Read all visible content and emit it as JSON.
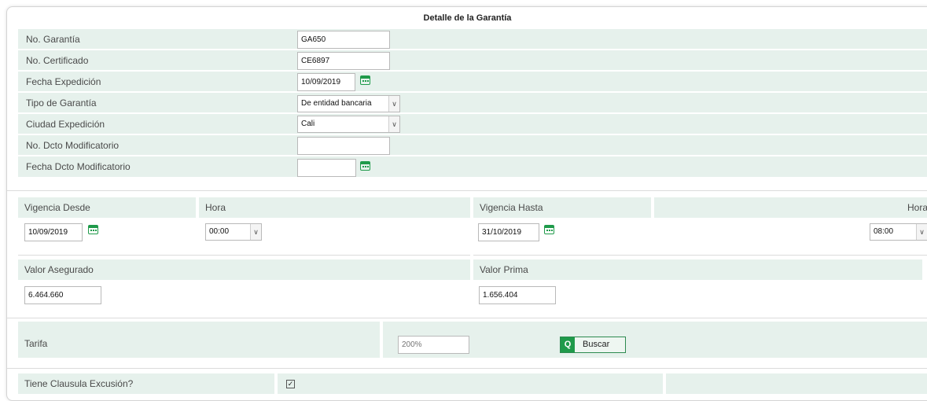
{
  "section_title": "Detalle de la Garantía",
  "fields": {
    "no_garantia": {
      "label": "No. Garantía",
      "value": "GA650"
    },
    "no_certificado": {
      "label": "No. Certificado",
      "value": "CE6897"
    },
    "fecha_expedicion": {
      "label": "Fecha Expedición",
      "value": "10/09/2019"
    },
    "tipo_garantia": {
      "label": "Tipo de Garantía",
      "value": "De entidad bancaria"
    },
    "ciudad_expedicion": {
      "label": "Ciudad Expedición",
      "value": "Cali"
    },
    "no_dcto_modificatorio": {
      "label": "No. Dcto Modificatorio",
      "value": ""
    },
    "fecha_dcto_modificatorio": {
      "label": "Fecha Dcto Modificatorio",
      "value": ""
    }
  },
  "vigencia": {
    "desde_label": "Vigencia Desde",
    "desde_value": "10/09/2019",
    "hora_desde_label": "Hora",
    "hora_desde_value": "00:00",
    "hasta_label": "Vigencia Hasta",
    "hasta_value": "31/10/2019",
    "hora_hasta_label": "Hora",
    "hora_hasta_value": "08:00"
  },
  "valores": {
    "asegurado_label": "Valor Asegurado",
    "asegurado_value": "6.464.660",
    "prima_label": "Valor Prima",
    "prima_value": "1.656.404"
  },
  "tarifa": {
    "label": "Tarifa",
    "placeholder": "200%",
    "buscar_label": "Buscar"
  },
  "clausula": {
    "label": "Tiene Clausula Excusión?",
    "checked": true,
    "check_glyph": "✓"
  },
  "colors": {
    "accent": "#1f9a4a",
    "label_bg": "#e6f1ec"
  },
  "icons": [
    "calendar-icon",
    "search-icon",
    "chevron-down-icon",
    "checkbox"
  ]
}
